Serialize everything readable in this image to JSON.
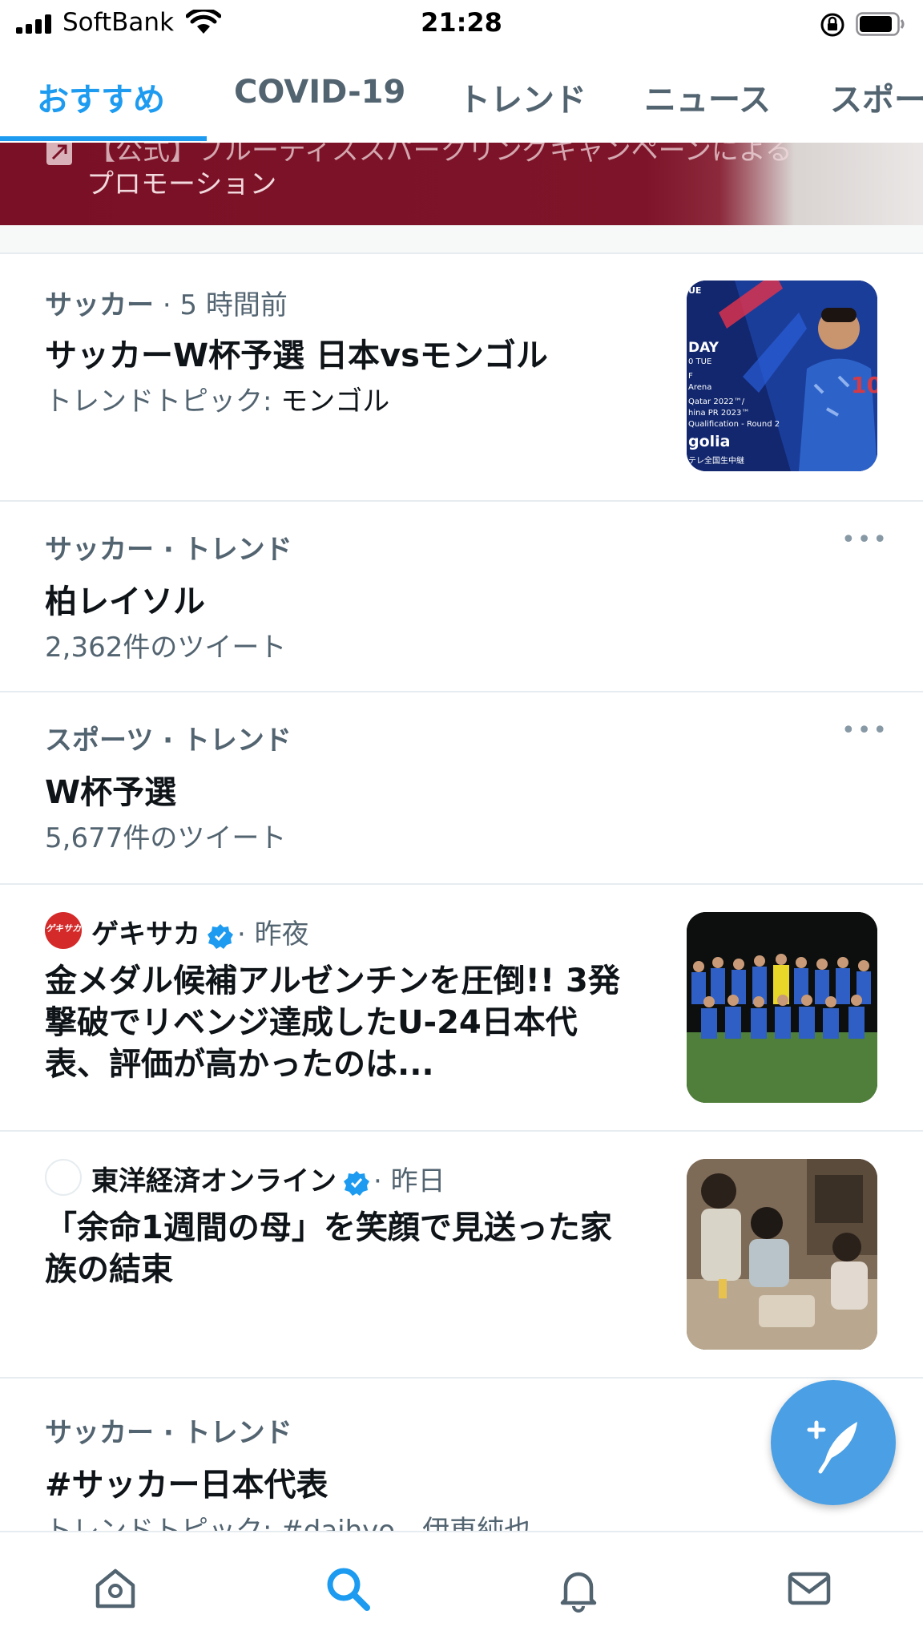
{
  "status_bar": {
    "carrier": "SoftBank",
    "time": "21:28"
  },
  "tabs": [
    {
      "label": "おすすめ",
      "active": true
    },
    {
      "label": "COVID-19"
    },
    {
      "label": "トレンド"
    },
    {
      "label": "ニュース"
    },
    {
      "label": "スポー"
    }
  ],
  "promo": {
    "text_top": "【公式】ブルーディススパークリングキャンペーンによる",
    "text": "プロモーション"
  },
  "items": [
    {
      "meta_category": "サッカー",
      "meta_time": "· 5 時間前",
      "title": "サッカーW杯予選 日本vsモンゴル",
      "sub_prefix": "トレンドトピック: ",
      "sub_value": "モンゴル",
      "thumb": {
        "lines": [
          "UE",
          "DAY",
          "0 TUE",
          "F",
          "Arena",
          "Qatar 2022™/",
          "hina PR 2023™",
          "Qualification - Round 2",
          "golia",
          "テレ全国生中継"
        ]
      }
    },
    {
      "meta": "サッカー · トレンド",
      "title": "柏レイソル",
      "sub": "2,362件のツイート",
      "more": "•••"
    },
    {
      "meta": "スポーツ · トレンド",
      "title": "W杯予選",
      "sub": "5,677件のツイート",
      "more": "•••"
    },
    {
      "source": "ゲキサカ",
      "source_logo": "ゲキサカ",
      "time": "· 昨夜",
      "headline": "金メダル候補アルゼンチンを圧倒!! 3発撃破でリベンジ達成したU-24日本代表、評価が高かったのは..."
    },
    {
      "source": "東洋経済オンライン",
      "time": "· 昨日",
      "headline": "「余命1週間の母」を笑顔で見送った家族の結束"
    },
    {
      "meta": "サッカー · トレンド",
      "title": "#サッカー日本代表",
      "sub": "トレンドトピック: #daihyo、伊東純也"
    }
  ],
  "colors": {
    "accent": "#1d9bf0",
    "fab": "#4a9fe5",
    "promo_bg": "#7a1025"
  },
  "bottom_nav": [
    "home-icon",
    "search-icon",
    "bell-icon",
    "mail-icon"
  ]
}
